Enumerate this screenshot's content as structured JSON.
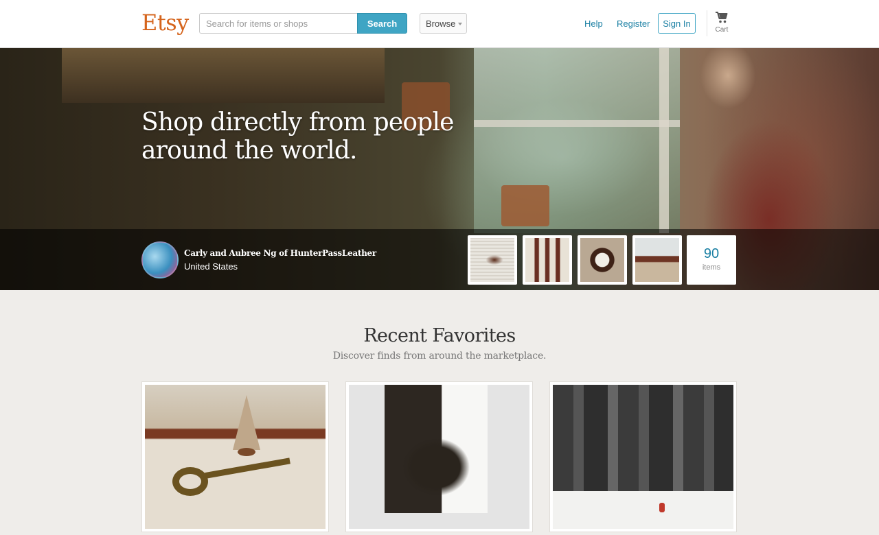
{
  "header": {
    "logo": "Etsy",
    "search": {
      "placeholder": "Search for items or shops",
      "value": "",
      "button_label": "Search"
    },
    "browse_label": "Browse",
    "nav": {
      "help": "Help",
      "register": "Register",
      "sign_in": "Sign In"
    },
    "cart_label": "Cart"
  },
  "hero": {
    "headline": "Shop directly from people around the world.",
    "shop_name": "Carly and Aubree Ng of HunterPassLeather",
    "shop_location": "United States",
    "items_count": "90",
    "items_label": "items"
  },
  "favorites": {
    "title": "Recent Favorites",
    "subtitle": "Discover finds from around the marketplace."
  },
  "colors": {
    "brand": "#d5641c",
    "accent": "#3fa5c4",
    "link": "#1a7fa3",
    "background": "#efedea"
  }
}
